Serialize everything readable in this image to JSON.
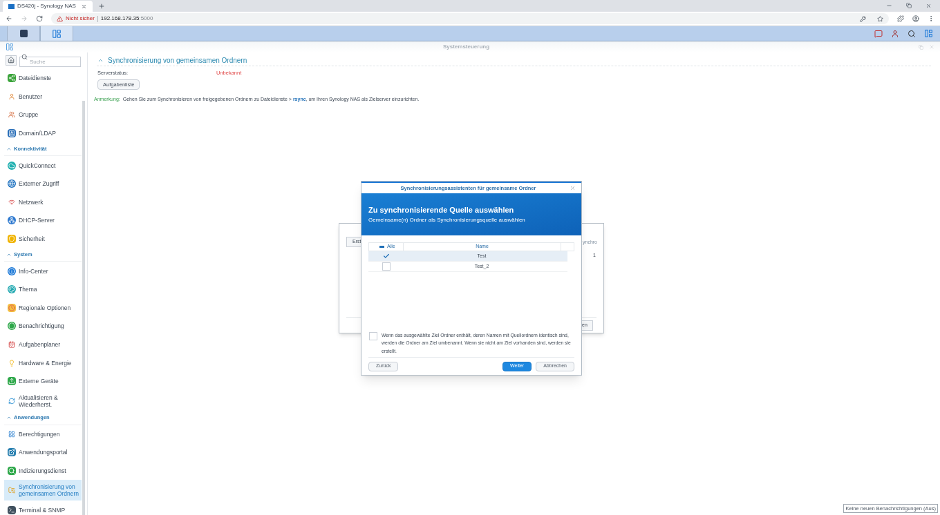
{
  "browser": {
    "tabs": [
      {
        "title": "DS420j - Synology NAS",
        "selected": true
      }
    ],
    "address": {
      "warning": "Nicht sicher",
      "host": "192.168.178.35",
      "port": ":5000"
    }
  },
  "taskbar": {
    "apps": [
      {
        "selected": false
      },
      {
        "selected": true
      }
    ]
  },
  "window": {
    "title": "Systemsteuerung"
  },
  "sidebar": {
    "search": {
      "placeholder": "Suche"
    },
    "groups": [
      {
        "items": [
          {
            "label": "Dateidienste",
            "selected": false
          },
          {
            "label": "Benutzer",
            "selected": false
          },
          {
            "label": "Gruppe",
            "selected": false
          },
          {
            "label": "Domain/LDAP",
            "selected": false
          }
        ]
      },
      {
        "header": "Konnektivität",
        "items": [
          {
            "label": "QuickConnect",
            "selected": false
          },
          {
            "label": "Externer Zugriff",
            "selected": false
          },
          {
            "label": "Netzwerk",
            "selected": false
          },
          {
            "label": "DHCP-Server",
            "selected": false
          },
          {
            "label": "Sicherheit",
            "selected": false
          }
        ]
      },
      {
        "header": "System",
        "items": [
          {
            "label": "Info-Center",
            "selected": false
          },
          {
            "label": "Thema",
            "selected": false
          },
          {
            "label": "Regionale Optionen",
            "selected": false
          },
          {
            "label": "Benachrichtigung",
            "selected": false
          },
          {
            "label": "Aufgabenplaner",
            "selected": false
          },
          {
            "label": "Hardware & Energie",
            "selected": false
          },
          {
            "label": "Externe Geräte",
            "selected": false
          },
          {
            "label": "Aktualisieren & Wiederherst.",
            "selected": false
          }
        ]
      },
      {
        "header": "Anwendungen",
        "items": [
          {
            "label": "Berechtigungen",
            "selected": false
          },
          {
            "label": "Anwendungsportal",
            "selected": false
          },
          {
            "label": "Indizierungsdienst",
            "selected": false
          },
          {
            "label": "Synchronisierung von gemeinsamen Ordnern",
            "selected": true
          },
          {
            "label": "Terminal & SNMP",
            "selected": false
          }
        ]
      }
    ]
  },
  "content": {
    "section_title": "Synchronisierung von gemeinsamen Ordnern",
    "server_status": {
      "label": "Serverstatus:",
      "value": "Unbekannt"
    },
    "button": "Aufgabenliste",
    "note": {
      "label": "Anmerkung:",
      "text": "Gehen Sie zum Synchronisieren von freigegebenen Ordnern zu Dateidienste > **rsync**, um Ihren Synology NAS als Zielserver einzurichten."
    }
  },
  "background_dialog": {
    "button_left": "Erst",
    "column": "ynchro",
    "cell": "1",
    "button_right": "en"
  },
  "dialog": {
    "title": "Synchronisierungsassistenten für gemeinsame Ordner",
    "heading": "Zu synchronisierende Quelle auswählen",
    "subheading": "Gemeinsame(n) Ordner als Synchronisierungsquelle auswählen",
    "table": {
      "select_all": {
        "label": "Alle",
        "indeterminate": true
      },
      "name_column": "Name",
      "rows": [
        {
          "name": "Test",
          "checked": true,
          "selected": true
        },
        {
          "name": "Test_2",
          "checked": false,
          "selected": false
        }
      ]
    },
    "option": {
      "checked": false,
      "text": "Wenn das ausgewählte Ziel Ordner enthält, deren Namen mit Quellordnern identisch sind, werden die Ordner am Ziel umbenannt. Wenn sie nicht am Ziel vorhanden sind, werden sie erstellt."
    },
    "buttons": [
      {
        "label": "Zurück",
        "kind": "secondary"
      },
      {
        "label": "Weiter",
        "kind": "primary"
      },
      {
        "label": "Abbrechen",
        "kind": "secondary"
      }
    ]
  },
  "notification": "Keine neuen Benachrichtigungen (Aus)"
}
